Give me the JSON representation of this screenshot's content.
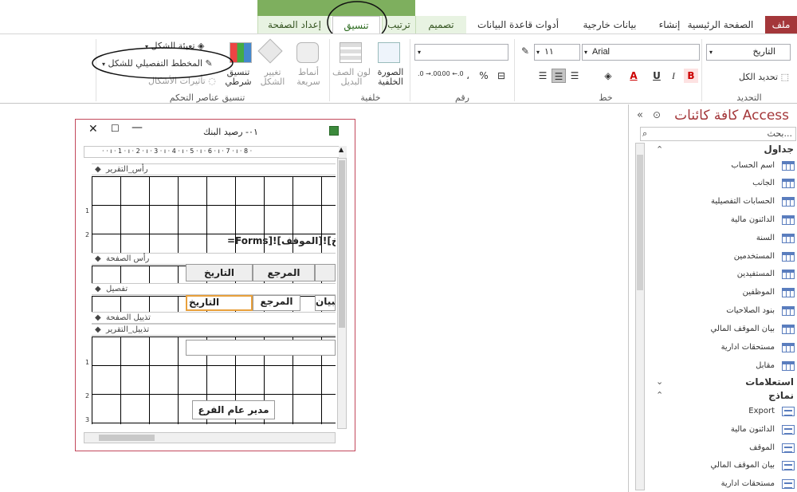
{
  "tabs": {
    "file": "ملف",
    "home": "الصفحة الرئيسية",
    "create": "إنشاء",
    "external": "بيانات خارجية",
    "dbtools": "أدوات قاعدة البيانات",
    "design": "تصميم",
    "arrange": "ترتيب",
    "format": "تنسيق",
    "pagesetup": "إعداد الصفحة"
  },
  "ribbon": {
    "selection": {
      "combo_value": "التاريخ",
      "select_all": "تحديد الكل",
      "group_label": "التحديد"
    },
    "font": {
      "font_name": "Arial",
      "font_size": "١١",
      "bold": "B",
      "italic": "I",
      "underline": "U",
      "group_label": "خط"
    },
    "number": {
      "combo_value": "",
      "percent": "%",
      "comma": "،",
      "inc_decimal": ".00 ←.0",
      "dec_decimal": ".0 →.00",
      "group_label": "رقم"
    },
    "background": {
      "image_label": "الصورة الخلفية",
      "alt_color_label": "لون الصف البديل",
      "group_label": "خلفية"
    },
    "control_formatting": {
      "quick_styles": "أنماط سريعة",
      "change_shape": "تغيير الشكل",
      "conditional": "تنسيق شرطي",
      "shape_fill": "تعبئة الشكل",
      "shape_outline": "المخطط التفصيلي للشكل",
      "shape_effects": "تأثيرات الأشكال",
      "group_label": "تنسيق عناصر التحكم"
    }
  },
  "report": {
    "title": "٠١- رصيد البنك",
    "sections": {
      "report_header": "رأس_التقرير",
      "page_header": "رأس الصفحة",
      "detail": "تفصيل",
      "page_footer": "تذييل الصفحة",
      "report_footer": "تذييل_التقرير"
    },
    "header_text": "=Forms]![الموقف]![تاريخ",
    "page_header_labels": [
      "التاريخ",
      "المرجع"
    ],
    "detail_fields": [
      "التاريخ",
      "المرجع",
      "لبيان"
    ],
    "footer_label": "مدير عام الفرع",
    "ruler_h": "· · ı · 1 · ı · 2 · ı · 3 · ı · 4 · ı · 5 · ı · 6 · ı · 7 · ı · 8 ·",
    "ruler_v_1": "1",
    "ruler_v_2": "2",
    "ruler_v_3": "1",
    "ruler_v_4": "2",
    "ruler_v_5": "3"
  },
  "nav": {
    "title": "كافة كائنات Access",
    "search_placeholder": "بحث...",
    "groups": {
      "tables": "جداول",
      "queries": "استعلامات",
      "forms": "نماذج"
    },
    "tables": [
      "اسم الحساب",
      "الجانب",
      "الحسابات التفصيلية",
      "الدائنون مالية",
      "السنة",
      "المستخدمين",
      "المستفيدين",
      "الموظفين",
      "بنود الصلاحيات",
      "بيان الموقف المالي",
      "مستحقات ادارية",
      "مقابل"
    ],
    "forms": [
      "Export",
      "الدائنون مالية",
      "الموقف",
      "بيان الموقف المالي",
      "مستحقات ادارية"
    ]
  }
}
